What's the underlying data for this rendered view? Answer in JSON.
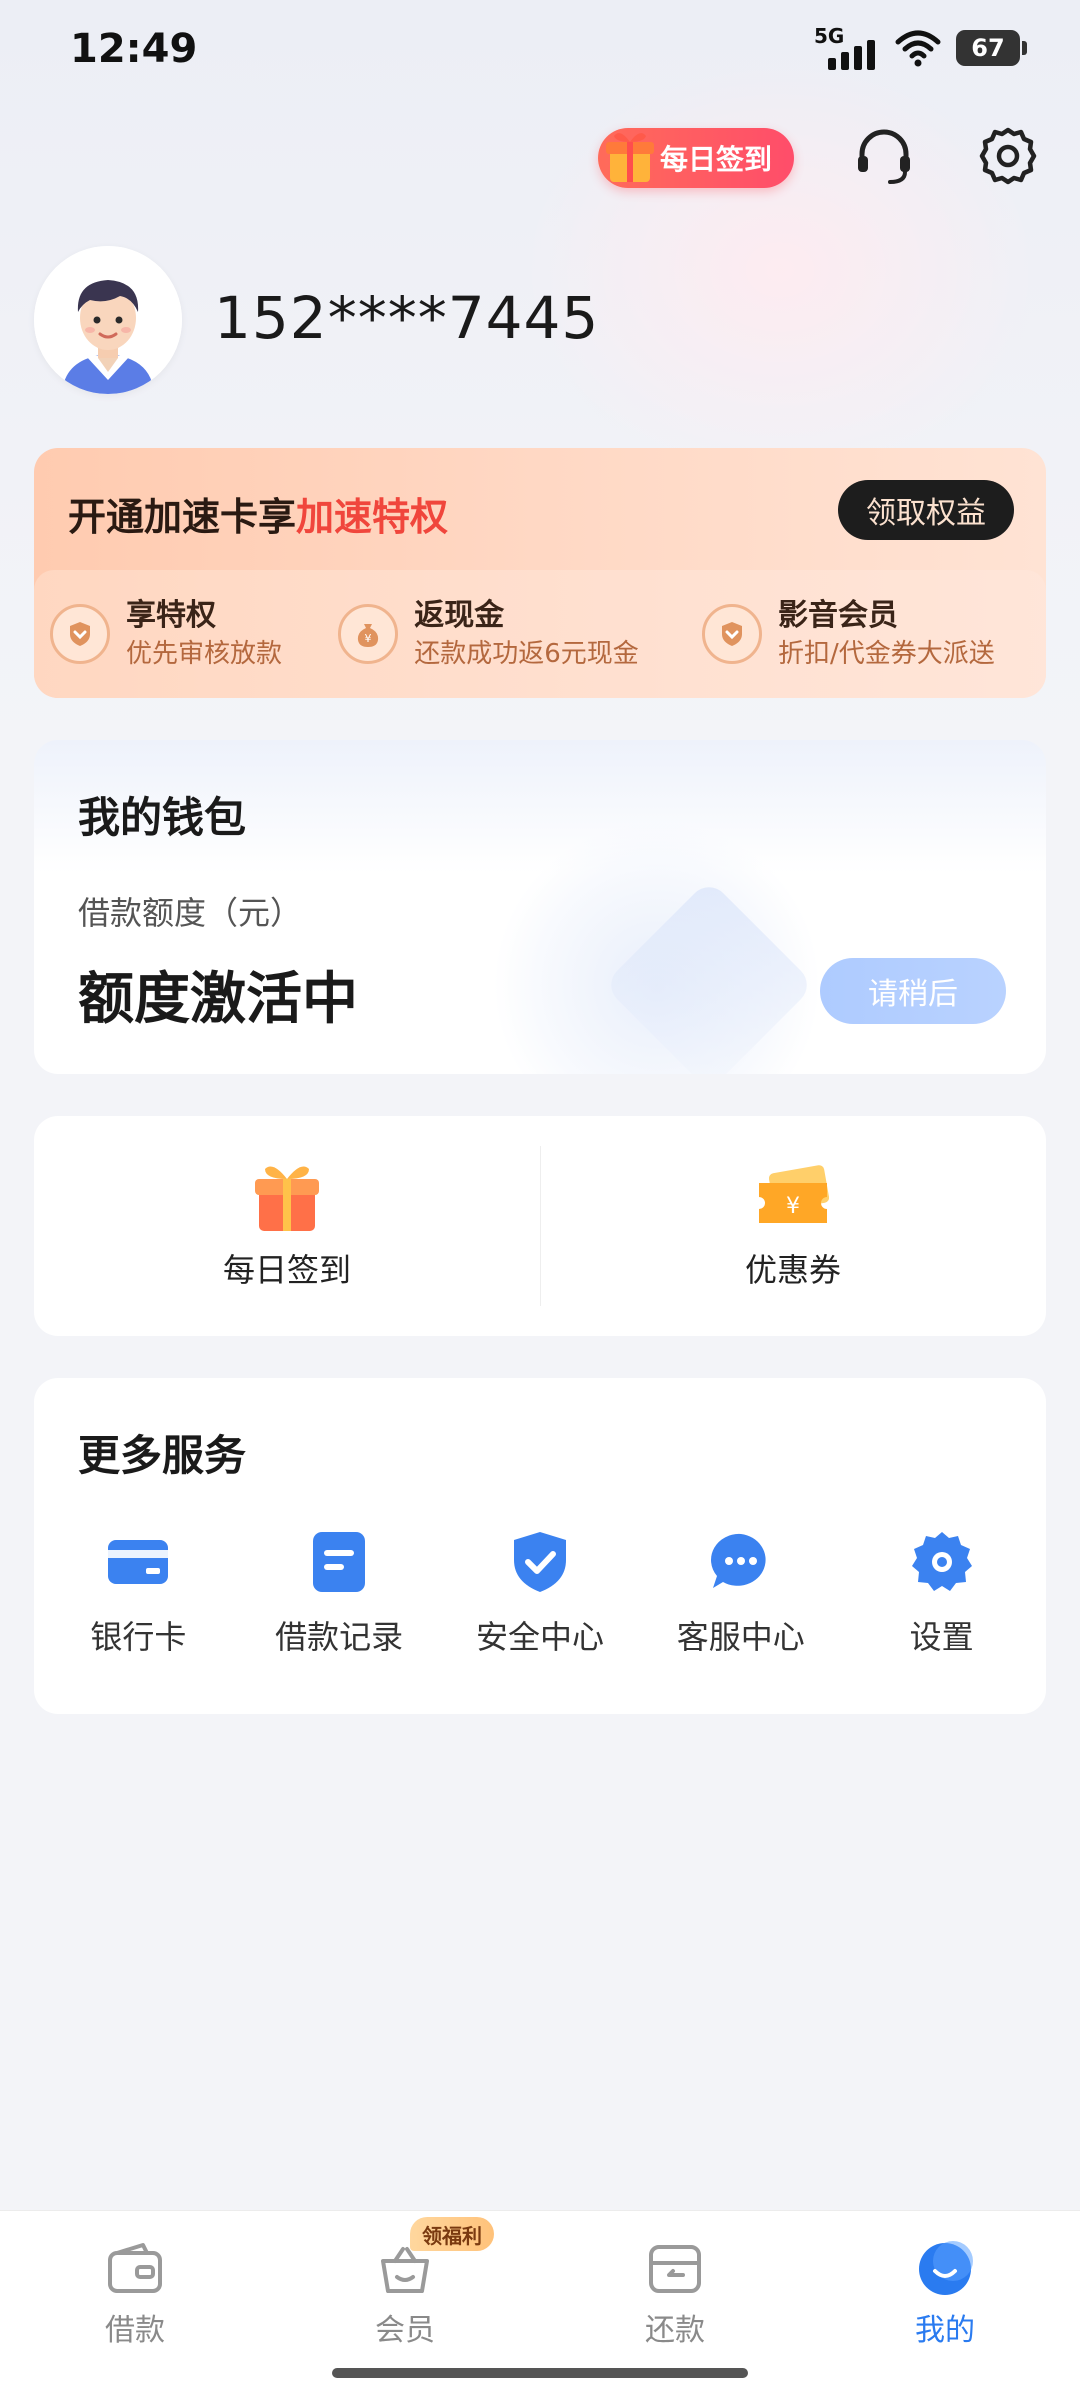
{
  "status_bar": {
    "time": "12:49",
    "network": "5G",
    "battery": "67"
  },
  "header": {
    "checkin_label": "每日签到"
  },
  "profile": {
    "phone": "152****7445"
  },
  "vip": {
    "title_prefix": "开通加速卡享",
    "title_highlight": "加速特权",
    "button": "领取权益",
    "benefits": [
      {
        "title": "享特权",
        "desc": "优先审核放款",
        "icon": "heart-badge-icon"
      },
      {
        "title": "返现金",
        "desc": "还款成功返6元现金",
        "icon": "money-bag-icon"
      },
      {
        "title": "影音会员",
        "desc": "折扣/代金券大派送",
        "icon": "heart-badge-icon"
      }
    ]
  },
  "wallet": {
    "title": "我的钱包",
    "label": "借款额度（元）",
    "status": "额度激活中",
    "button": "请稍后"
  },
  "quick_actions": [
    {
      "label": "每日签到",
      "icon": "gift-icon"
    },
    {
      "label": "优惠券",
      "icon": "coupon-icon"
    }
  ],
  "services": {
    "title": "更多服务",
    "items": [
      {
        "label": "银行卡",
        "icon": "card-icon"
      },
      {
        "label": "借款记录",
        "icon": "record-icon"
      },
      {
        "label": "安全中心",
        "icon": "shield-icon"
      },
      {
        "label": "客服中心",
        "icon": "chat-icon"
      },
      {
        "label": "设置",
        "icon": "gear-icon"
      }
    ]
  },
  "nav": {
    "items": [
      {
        "label": "借款",
        "icon": "wallet-icon"
      },
      {
        "label": "会员",
        "icon": "basket-icon",
        "badge": "领福利"
      },
      {
        "label": "还款",
        "icon": "repay-icon"
      },
      {
        "label": "我的",
        "icon": "profile-icon",
        "active": true
      }
    ]
  },
  "colors": {
    "accent": "#2a7bf0",
    "highlight": "#f0463c",
    "vip_bg": "#ffcbb0"
  }
}
